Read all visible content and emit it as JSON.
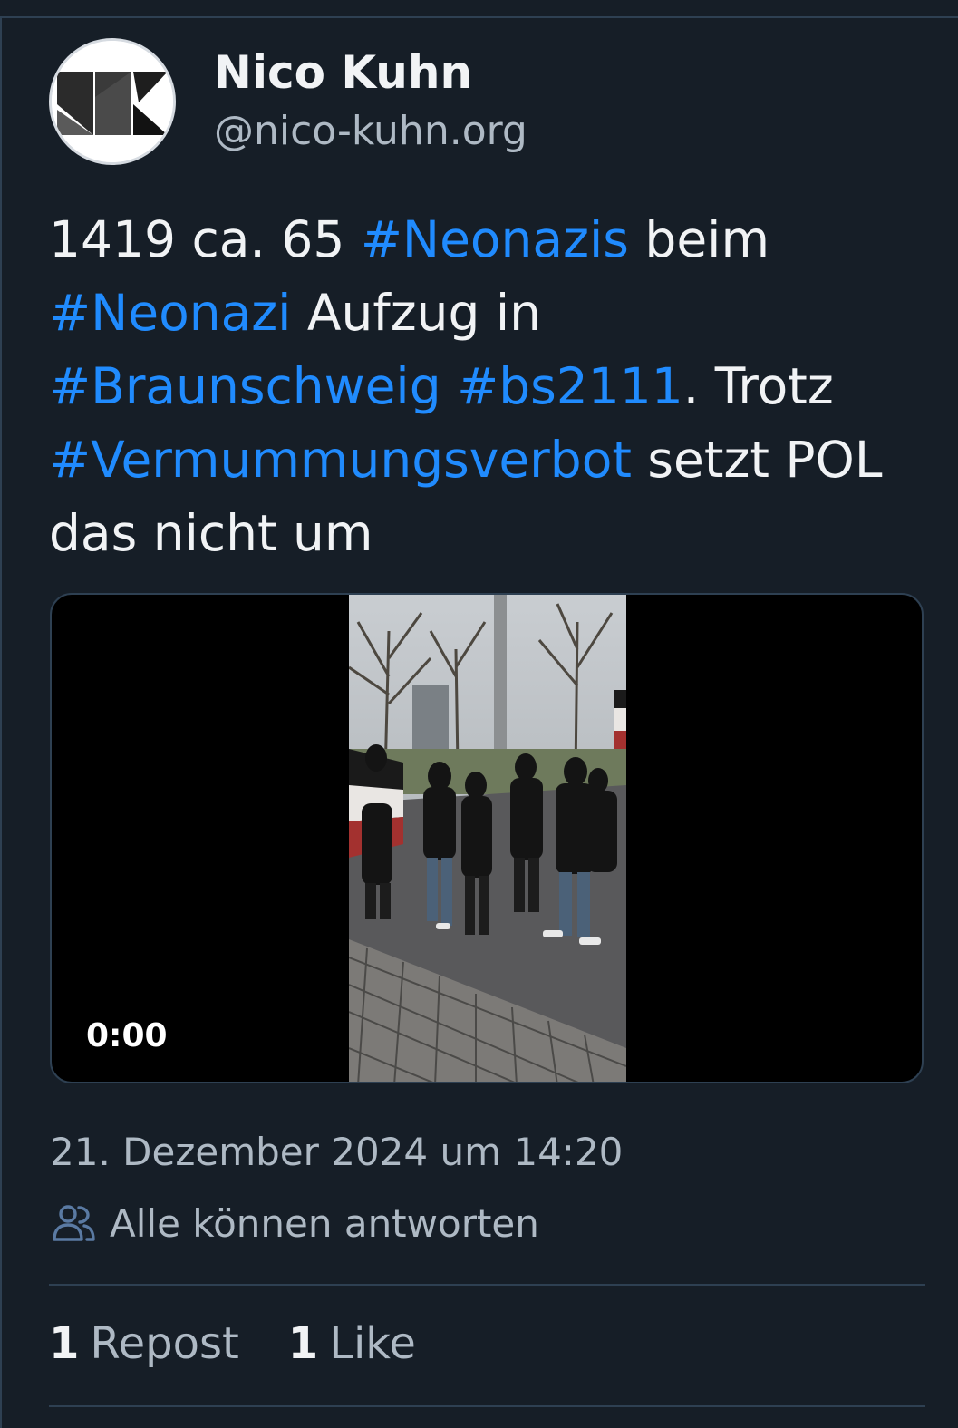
{
  "author": {
    "display_name": "Nico Kuhn",
    "handle": "@nico-kuhn.org",
    "avatar_icon": "nk-logo-icon"
  },
  "post": {
    "segments": [
      {
        "text": "1419 ca. 65 ",
        "type": "text"
      },
      {
        "text": "#Neonazis",
        "type": "hashtag"
      },
      {
        "text": " beim ",
        "type": "text"
      },
      {
        "text": "#Neonazi",
        "type": "hashtag"
      },
      {
        "text": " Aufzug in ",
        "type": "text"
      },
      {
        "text": "#Braunschweig",
        "type": "hashtag"
      },
      {
        "text": " ",
        "type": "text"
      },
      {
        "text": "#bs2111",
        "type": "hashtag"
      },
      {
        "text": ". Trotz ",
        "type": "text"
      },
      {
        "text": "#Vermummungsverbot",
        "type": "hashtag"
      },
      {
        "text": " setzt POL das nicht um",
        "type": "text"
      }
    ]
  },
  "video": {
    "time": "0:00"
  },
  "meta": {
    "timestamp": "21. Dezember 2024 um 14:20",
    "reply_setting": "Alle können antworten",
    "reply_icon": "people-icon"
  },
  "stats": {
    "reposts_count": "1",
    "reposts_label": "Repost",
    "likes_count": "1",
    "likes_label": "Like"
  },
  "colors": {
    "background": "#161e27",
    "hashtag": "#208bfe",
    "muted_text": "#aeb9c4",
    "divider": "#2e4052"
  }
}
